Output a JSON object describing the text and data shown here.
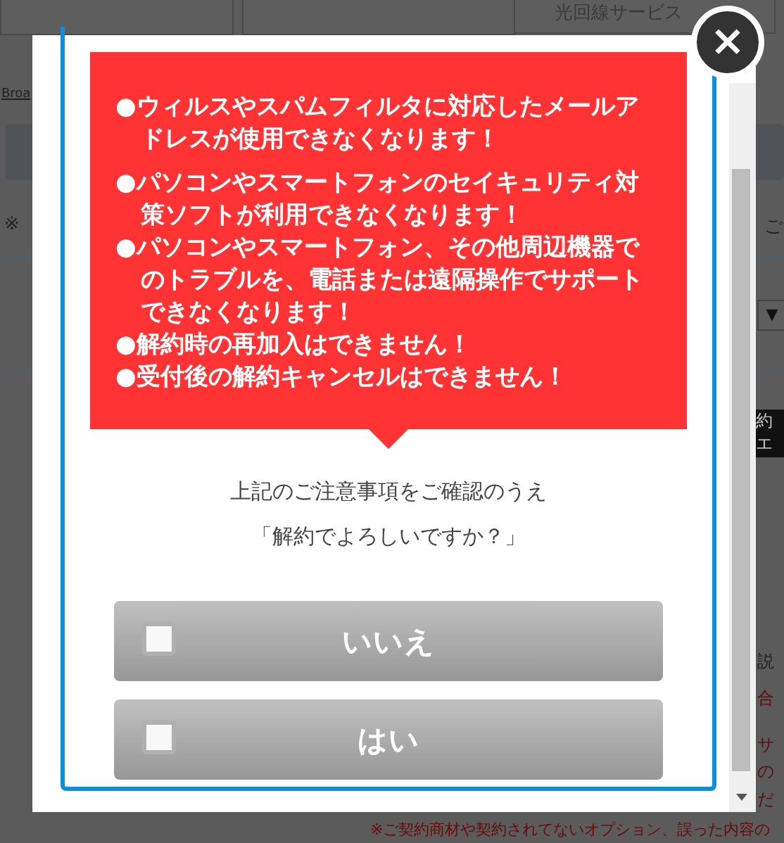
{
  "background": {
    "tab_text": "光回線サービス",
    "link": "Broa",
    "note_left": "※",
    "note_right": "ご",
    "dropdown_arrow": "▼",
    "dark_label": [
      "約",
      "エ"
    ],
    "side_texts": [
      "説",
      "合",
      "サ",
      "の",
      "だ"
    ],
    "bottom_note": "※ご契約商材や契約されてないオプション、誤った内容の"
  },
  "dialog": {
    "close": "×",
    "warnings": [
      "●ウィルスやスパムフィルタに対応したメールアドレスが使用できなくなります！",
      "●パソコンやスマートフォンのセイキュリティ対策ソフトが利用できなくなります！",
      "●パソコンやスマートフォン、その他周辺機器でのトラブルを、電話または遠隔操作でサポートできなくなります！",
      "●解約時の再加入はできません！",
      "●受付後の解約キャンセルはできません！"
    ],
    "message": [
      "上記のご注意事項をご確認のうえ",
      "「解約でよろしいですか？」"
    ],
    "options": [
      {
        "label": "いいえ",
        "checked": false
      },
      {
        "label": "はい",
        "checked": false
      }
    ]
  }
}
